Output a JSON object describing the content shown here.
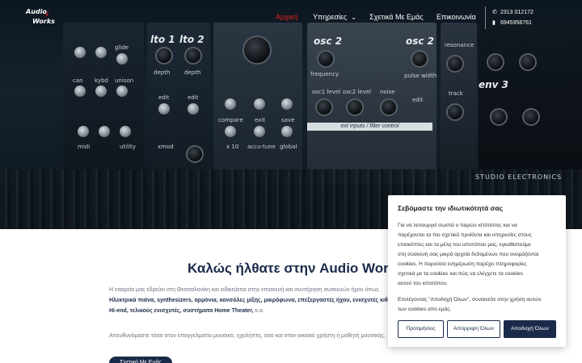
{
  "brand": {
    "line1": "Audio",
    "line2": "Works",
    "logo_accent": "#e0231d"
  },
  "nav": {
    "items": [
      {
        "label": "Αρχική",
        "active": true
      },
      {
        "label": "Υπηρεσίες",
        "has_dropdown": true
      },
      {
        "label": "Σχετικά Με Εμάς"
      },
      {
        "label": "Επικοινωνία"
      }
    ],
    "phone": "2313 012172",
    "mobile": "6945958761"
  },
  "hero": {
    "labels": {
      "lto1": "lto 1",
      "lto2": "lto 2",
      "osc2a": "osc 2",
      "osc2b": "osc 2",
      "env3": "env 3",
      "depth1": "depth",
      "depth2": "depth",
      "frequency": "frequency",
      "pulse_width": "pulse width",
      "edit1": "edit",
      "edit2": "edit",
      "edit3": "edit",
      "compare": "compare",
      "exit": "exit",
      "save": "save",
      "x10": "x 10",
      "accu_tune": "accu-tune",
      "global": "global",
      "osc1_level": "osc1 level",
      "osc2_level": "osc2 level",
      "noise": "noise",
      "track": "track",
      "xmod": "xmod",
      "midi": "midi",
      "utility": "utility",
      "can": "can",
      "kybd": "kybd",
      "unison": "unison",
      "glide": "glide",
      "resonance": "resonance",
      "strip": "ext inputs / filter control",
      "brand": "STUDIO ELECTRONICS"
    }
  },
  "welcome": {
    "title": "Καλώς ήλθατε στην Audio Works"
  },
  "about": {
    "line1": "Η εταιρεία μας εδρεύει στη Θεσσαλονίκη και ειδικεύεται στην επισκευή και συντήρηση συσκευών ήχου όπως",
    "line2": "Ηλεκτρικά πιάνα, synthesizers, αρμόνια, κονσόλες μίξης, μικρόφωνα, επεξεργαστές ήχου, ενισχυτές κιθάρας,",
    "line3_bold": "Hi-end, τελικούς ενισχυτές, συστήματα Home Theater,",
    "line3_tail": " κ.α.",
    "line4": "Απευθυνόμαστε τόσο στον επαγγελματία μουσικό, ηχολήπτη, όσο και στον οικιακό χρήστη ή μαθητή μουσικής."
  },
  "cta": {
    "label": "Σχετικά Με Εμάς"
  },
  "cookie": {
    "title": "Σεβόμαστε την ιδιωτικότητά σας",
    "body_lines": [
      "Για να λειτουργεί σωστά ο παρών ιστότοπος και να",
      "παρέχονται τα πιο σχετικά προϊόντα και υπηρεσίες στους",
      "επισκέπτες και τα μέλη του ιστοτόπου μας, εγκαθιστούμε",
      "στη συσκευή σας μικρά αρχεία δεδομένων που ονομάζονται",
      "cookies. Η παρούσα ενημέρωση παρέχει πληροφορίες",
      "σχετικά με τα cookies και πώς να ελέγχετε τα cookies",
      "αυτού του ιστοτόπου."
    ],
    "consent_lines": [
      "Επιλέγοντας \"Αποδοχή Όλων\", συναινείτε στην χρήση αυτών",
      "των cookies απο εμάς."
    ],
    "buttons": {
      "preferences": "Προτιμήσεις",
      "reject": "Απόρριψη Όλων",
      "accept": "Αποδοχή Όλων"
    }
  },
  "colors": {
    "navy": "#1a2a4a",
    "red": "#e0231d",
    "hero_dark": "#0f1a24"
  }
}
